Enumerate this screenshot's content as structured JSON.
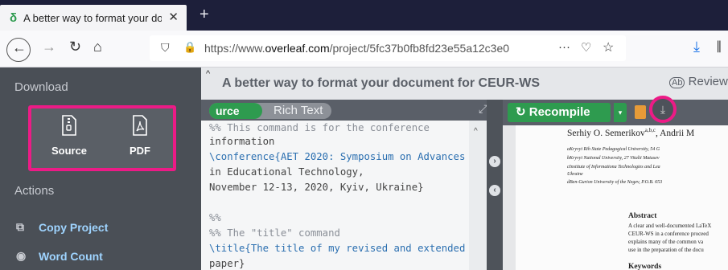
{
  "browser": {
    "tab_title": "A better way to format your do",
    "tab_close": "✕",
    "new_tab": "+",
    "url_prefix": "https://www.",
    "url_domain": "overleaf.com",
    "url_path": "/project/5fc37b0fb8fd23e55a12c3e0",
    "more": "···"
  },
  "sidebar": {
    "download_heading": "Download",
    "download_items": [
      {
        "label": "Source",
        "icon": "zip-file-icon"
      },
      {
        "label": "PDF",
        "icon": "pdf-file-icon"
      }
    ],
    "actions_heading": "Actions",
    "actions": [
      {
        "label": "Copy Project",
        "icon": "copy-icon"
      },
      {
        "label": "Word Count",
        "icon": "eye-icon"
      }
    ]
  },
  "header": {
    "title": "A better way to format your document for CEUR-WS",
    "review": "Review"
  },
  "editor": {
    "source_tab": "urce",
    "rich_text_tab": "Rich Text",
    "lines": [
      "%% This command is for the conference",
      "information",
      "\\conference{AET 2020: Symposium on Advances",
      "in Educational Technology,",
      "  November 12-13, 2020, Kyiv, Ukraine}",
      "",
      "%%",
      "%% The \"title\" command",
      "\\title{The title of my revised and extended",
      "paper}"
    ]
  },
  "pdf": {
    "recompile": "Recompile",
    "authors": "Serhiy O. Semerikov",
    "authors_sup": "a,b,c",
    "authors_tail": ", Andrii M",
    "affiliations": [
      "aKryvyi Rih State Pedagogical University, 54 G",
      "bKryvyi National University, 27 Vitalii Matusev",
      "cInstitute of Informationa Technologies and Lea",
      "Ukraine",
      "dBen-Gurion University of the Negev, P.O.B. 653"
    ],
    "abstract_heading": "Abstract",
    "abstract_lines": [
      "A clear and well-documented LaTeX",
      "CEUR-WS in a conference proceed",
      "explains many of the common va",
      "use in the preparation of the docu"
    ],
    "keywords_heading": "Keywords"
  },
  "colors": {
    "highlight": "#ec1b86",
    "accent_green": "#2e9b4f",
    "link_blue": "#9fd4ff"
  }
}
